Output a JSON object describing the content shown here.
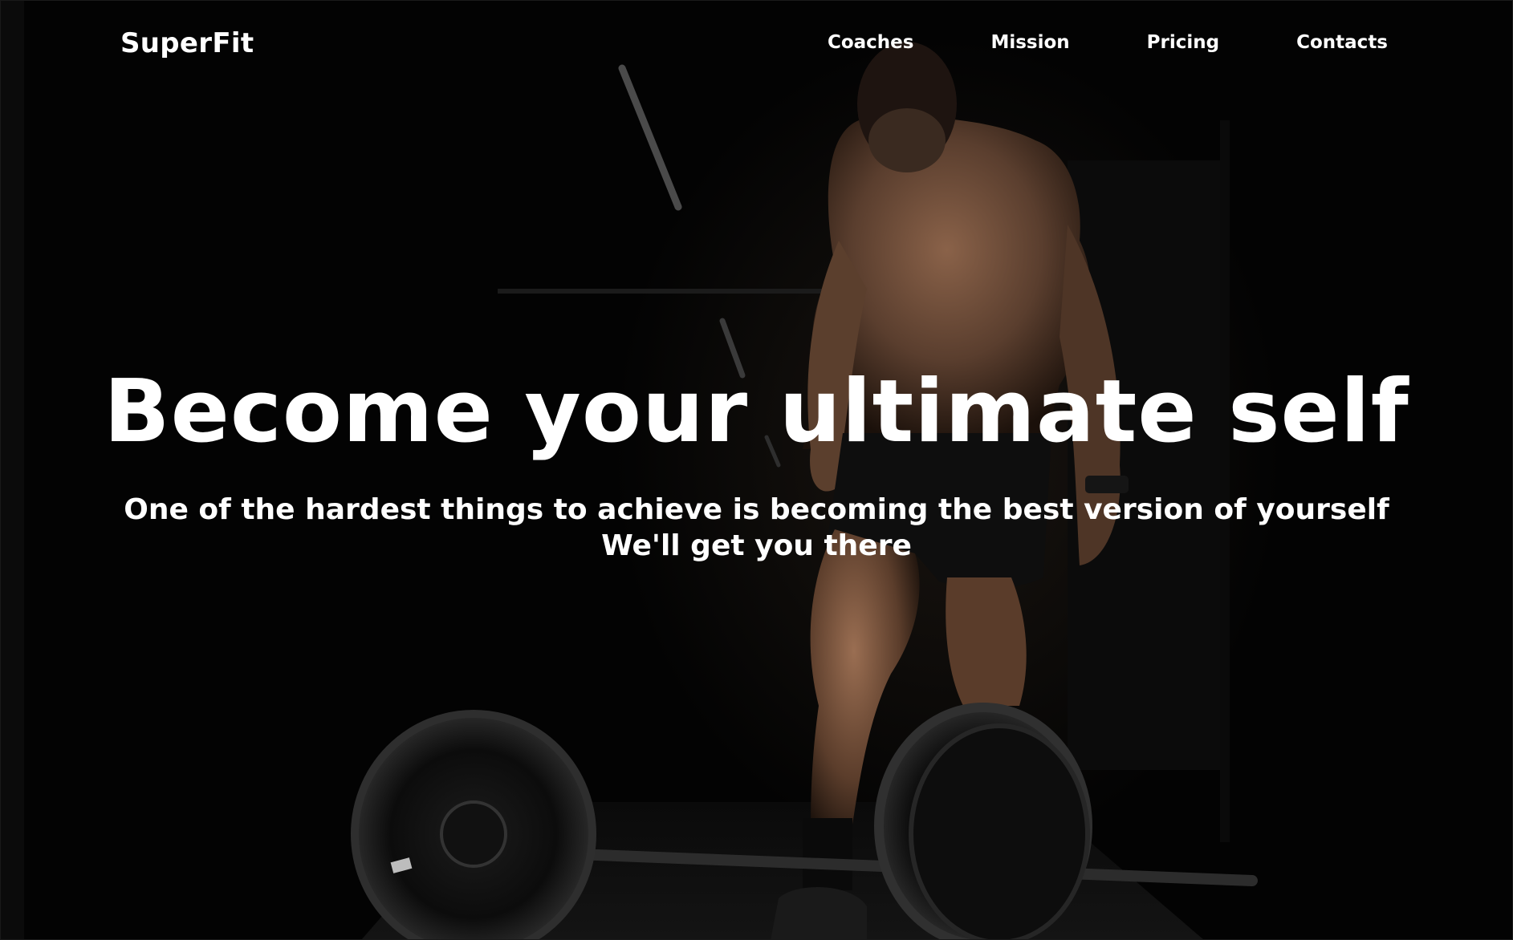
{
  "navbar": {
    "brand": "SuperFit",
    "links": [
      {
        "label": "Coaches"
      },
      {
        "label": "Mission"
      },
      {
        "label": "Pricing"
      },
      {
        "label": "Contacts"
      }
    ]
  },
  "hero": {
    "title": "Become your ultimate self",
    "subtitle_line1": "One of the hardest things to achieve is becoming the best version of yourself",
    "subtitle_line2": "We'll get you there"
  },
  "colors": {
    "background": "#020202",
    "text": "#ffffff",
    "skin": "#6b4a36"
  }
}
